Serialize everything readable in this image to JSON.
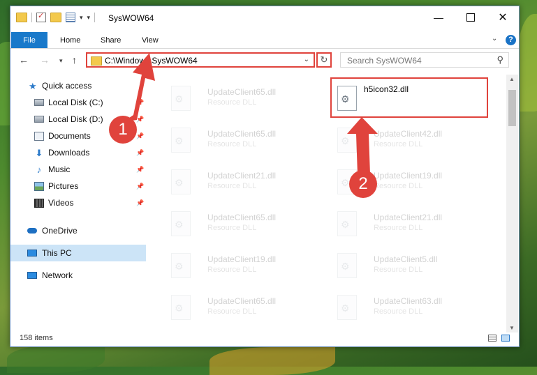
{
  "window": {
    "title": "SysWOW64"
  },
  "ribbon": {
    "tabs": [
      "File",
      "Home",
      "Share",
      "View"
    ],
    "help": "?"
  },
  "address": {
    "path": "C:\\Windows\\SysWOW64",
    "search_placeholder": "Search SysWOW64"
  },
  "sidebar": {
    "items": [
      {
        "label": "Quick access",
        "icon": "star-icon",
        "pinned": false
      },
      {
        "label": "Local Disk (C:)",
        "icon": "drive-icon",
        "pinned": true
      },
      {
        "label": "Local Disk (D:)",
        "icon": "drive-icon",
        "pinned": true
      },
      {
        "label": "Documents",
        "icon": "documents-icon",
        "pinned": true
      },
      {
        "label": "Downloads",
        "icon": "download-icon",
        "pinned": true
      },
      {
        "label": "Music",
        "icon": "music-icon",
        "pinned": true
      },
      {
        "label": "Pictures",
        "icon": "pictures-icon",
        "pinned": true
      },
      {
        "label": "Videos",
        "icon": "videos-icon",
        "pinned": true
      },
      {
        "label": "OneDrive",
        "icon": "cloud-icon",
        "pinned": false
      },
      {
        "label": "This PC",
        "icon": "computer-icon",
        "pinned": false,
        "selected": true
      },
      {
        "label": "Network",
        "icon": "network-icon",
        "pinned": false
      }
    ]
  },
  "files": [
    {
      "name": "UpdateClient65.dll",
      "type": "Resource DLL"
    },
    {
      "name": "h5icon32.dll",
      "type": "",
      "highlighted": true
    },
    {
      "name": "UpdateClient65.dll",
      "type": "Resource DLL"
    },
    {
      "name": "UpdateClient42.dll",
      "type": "Resource DLL"
    },
    {
      "name": "UpdateClient21.dll",
      "type": "Resource DLL"
    },
    {
      "name": "UpdateClient19.dll",
      "type": "Resource DLL"
    },
    {
      "name": "UpdateClient65.dll",
      "type": "Resource DLL"
    },
    {
      "name": "UpdateClient21.dll",
      "type": "Resource DLL"
    },
    {
      "name": "UpdateClient19.dll",
      "type": "Resource DLL"
    },
    {
      "name": "UpdateClient5.dll",
      "type": "Resource DLL"
    },
    {
      "name": "UpdateClient65.dll",
      "type": "Resource DLL"
    },
    {
      "name": "UpdateClient63.dll",
      "type": "Resource DLL"
    }
  ],
  "status": {
    "item_count": "158 items"
  },
  "annotations": {
    "step1": "1",
    "step2": "2",
    "color": "#e0433c"
  }
}
